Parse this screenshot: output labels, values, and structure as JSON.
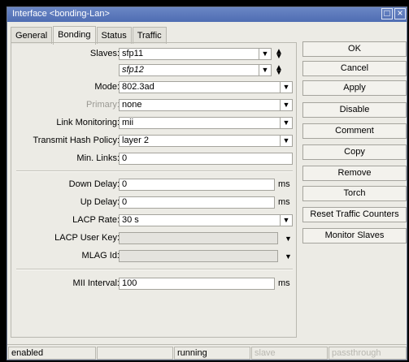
{
  "window": {
    "title": "Interface <bonding-Lan>"
  },
  "tabs": [
    {
      "label": "General",
      "active": false
    },
    {
      "label": "Bonding",
      "active": true
    },
    {
      "label": "Status",
      "active": false
    },
    {
      "label": "Traffic",
      "active": false
    }
  ],
  "form": {
    "slaves_label": "Slaves:",
    "slave1": "sfp11",
    "slave2": "sfp12",
    "mode_label": "Mode:",
    "mode_value": "802.3ad",
    "primary_label": "Primary:",
    "primary_value": "none",
    "link_monitoring_label": "Link Monitoring:",
    "link_monitoring_value": "mii",
    "hash_policy_label": "Transmit Hash Policy:",
    "hash_policy_value": "layer 2",
    "min_links_label": "Min. Links:",
    "min_links_value": "0",
    "down_delay_label": "Down Delay:",
    "down_delay_value": "0",
    "up_delay_label": "Up Delay:",
    "up_delay_value": "0",
    "lacp_rate_label": "LACP Rate:",
    "lacp_rate_value": "30 s",
    "lacp_user_key_label": "LACP User Key:",
    "lacp_user_key_value": "",
    "mlag_id_label": "MLAG Id:",
    "mlag_id_value": "",
    "mii_interval_label": "MII Interval:",
    "mii_interval_value": "100",
    "unit_ms": "ms"
  },
  "buttons": {
    "ok": "OK",
    "cancel": "Cancel",
    "apply": "Apply",
    "disable": "Disable",
    "comment": "Comment",
    "copy": "Copy",
    "remove": "Remove",
    "torch": "Torch",
    "reset_traffic": "Reset Traffic Counters",
    "monitor_slaves": "Monitor Slaves"
  },
  "status": {
    "enabled": "enabled",
    "running": "running",
    "slave": "slave",
    "passthrough": "passthrough"
  },
  "icons": {
    "dropdown": "dropdown-arrow-icon",
    "updown": "updown-arrow-icon",
    "maximize": "maximize-icon",
    "close": "close-icon"
  }
}
